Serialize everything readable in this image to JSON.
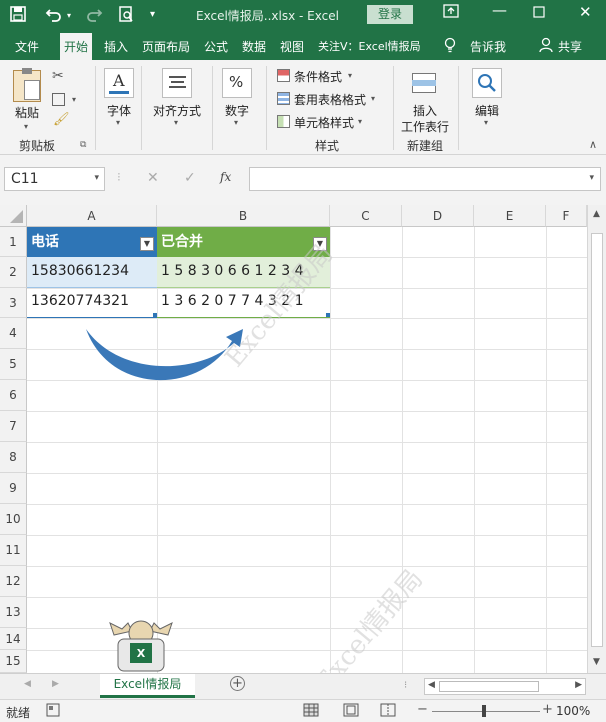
{
  "titlebar": {
    "title": "Excel情报局..xlsx  -  Excel",
    "login_label": "登录"
  },
  "tabs": [
    "文件",
    "开始",
    "插入",
    "页面布局",
    "公式",
    "数据",
    "视图",
    "关注V：Excel情报局",
    "告诉我",
    "共享"
  ],
  "ribbon": {
    "paste": "粘贴",
    "clipboard": "剪贴板",
    "font": "字体",
    "align": "对齐方式",
    "number": "数字",
    "percent_symbol": "%",
    "cond_format": "条件格式",
    "table_format": "套用表格格式",
    "cell_style": "单元格样式",
    "styles": "样式",
    "insert_ws": "插入",
    "insert_ws2": "工作表行",
    "new_group": "新建组",
    "edit": "编辑"
  },
  "formula_bar": {
    "name_box": "C11",
    "fx": "fx",
    "value": ""
  },
  "grid": {
    "columns": [
      "A",
      "B",
      "C",
      "D",
      "E",
      "F"
    ],
    "rows": [
      "1",
      "2",
      "3",
      "4",
      "5",
      "6",
      "7",
      "8",
      "9",
      "10",
      "11",
      "12",
      "13",
      "14",
      "15"
    ],
    "header_a": "电话",
    "header_b": "已合并",
    "a2": "15830661234",
    "a3": "13620774321",
    "b2": "1 5 8 3 0 6 6 1 2 3 4",
    "b3": "1 3 6 2 0 7 7 4 3 2 1",
    "watermark": "Excel情报局",
    "watermark2": "Excel情报局"
  },
  "sheet_tab": "Excel情报局",
  "status": {
    "ready": "就绪",
    "zoom": "100%"
  },
  "colors": {
    "excel_green": "#217346",
    "header_blue": "#2e75b6",
    "header_green": "#70ad47",
    "arrow_blue": "#3a78b8"
  }
}
